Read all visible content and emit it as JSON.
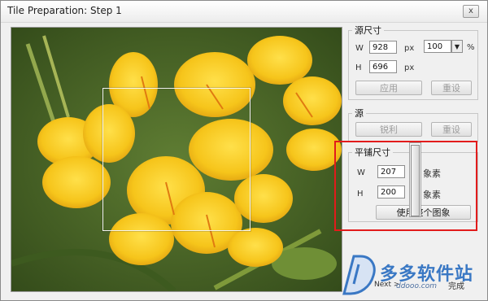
{
  "window": {
    "title": "Tile Preparation: Step 1",
    "close_glyph": "x"
  },
  "source_size": {
    "group_label": "源尺寸",
    "w_label": "W",
    "w_value": "928",
    "h_label": "H",
    "h_value": "696",
    "px_w": "px",
    "px_h": "px",
    "percent_value": "100",
    "percent_sign": "%",
    "apply_label": "应用",
    "reset_label": "重设"
  },
  "source": {
    "group_label": "源",
    "sharpen_label": "锐利",
    "reset_label": "重设"
  },
  "tile_size": {
    "group_label": "平铺尺寸",
    "w_label": "W",
    "w_value": "207",
    "w_unit": "象素",
    "h_label": "H",
    "h_value": "200",
    "h_unit": "象素",
    "use_image_label": "使用整个图象"
  },
  "footer": {
    "next_label": "Next >",
    "done_label": "完成"
  },
  "watermark": {
    "brand": "多多软件站",
    "url": "ddooo.com"
  },
  "colors": {
    "highlight": "#e21b1b",
    "flower": "#f6c51b",
    "foliage": "#4f6b2a"
  }
}
